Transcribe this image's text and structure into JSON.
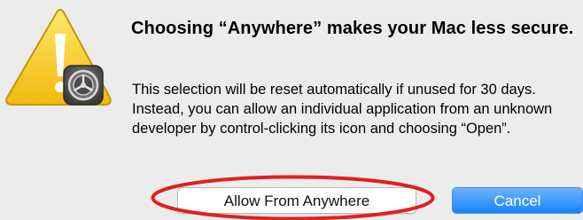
{
  "dialog": {
    "icon": "warning-triangle-with-system-preferences-icon",
    "heading": "Choosing “Anywhere” makes your Mac less secure.",
    "body": "This selection will be reset automatically if unused for 30 days. Instead, you can allow an individual application from an unknown developer by control-clicking its icon and choosing “Open”.",
    "buttons": {
      "allow_label": "Allow From Anywhere",
      "cancel_label": "Cancel"
    }
  },
  "annotation": {
    "shape": "ellipse",
    "color": "#e02020",
    "target": "allow-from-anywhere-button"
  },
  "colors": {
    "accent": "#1a82fb",
    "warning": "#f5c214"
  }
}
